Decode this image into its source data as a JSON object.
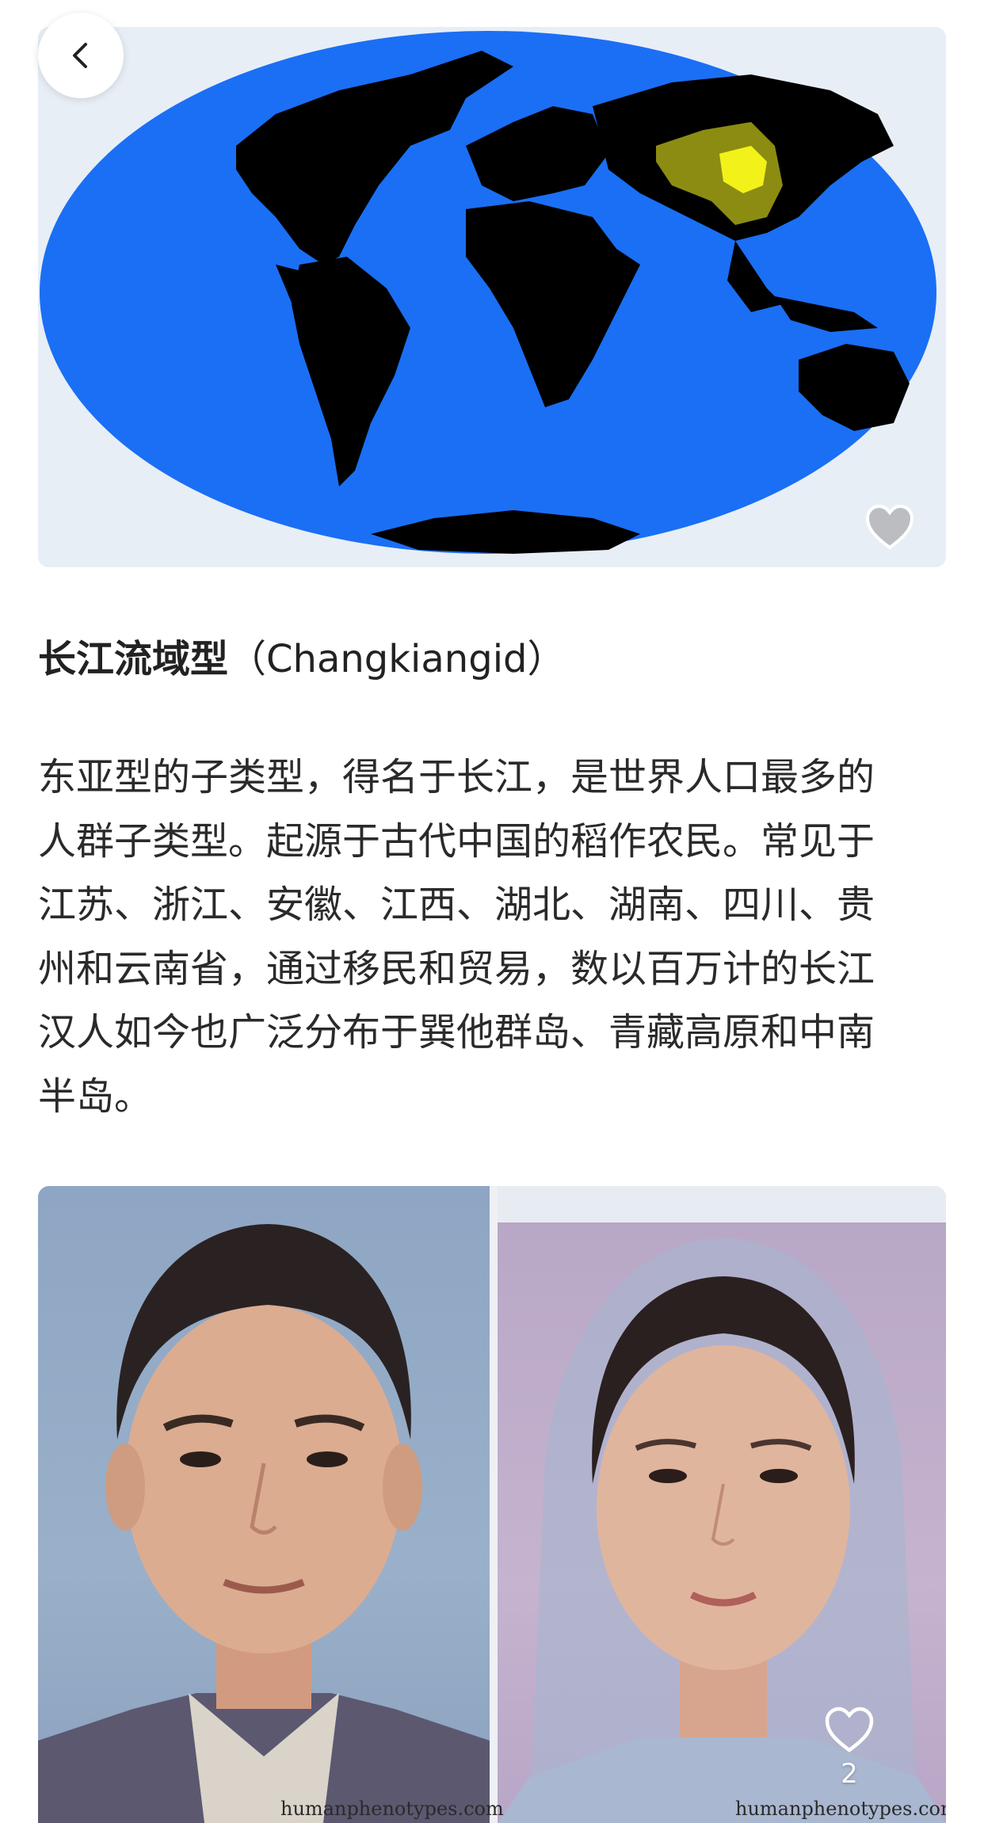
{
  "nav": {
    "back_icon": "chevron-left-icon"
  },
  "map_card": {
    "like_icon": "heart-icon",
    "colors": {
      "ocean": "#1a6ff5",
      "land": "#000000",
      "region_outer": "#8c8c12",
      "region_inner": "#f2f21a"
    }
  },
  "title": {
    "zh": "长江流域型",
    "en": "（Changkiangid）"
  },
  "description": {
    "lines": [
      "东亚型的子类型，得名于长江，是世界人口最多的",
      "人群子类型。起源于古代中国的稻作农民。常见于",
      "江苏、浙江、安徽、江西、湖北、湖南、四川、贵",
      "州和云南省，通过移民和贸易，数以百万计的长江",
      "汉人如今也广泛分布于巽他群岛、青藏高原和中南",
      "半岛。"
    ]
  },
  "faces_card": {
    "watermark_left": "humanphenotypes.com",
    "watermark_right": "humanphenotypes.com",
    "like_icon": "heart-icon",
    "like_count": "2"
  }
}
